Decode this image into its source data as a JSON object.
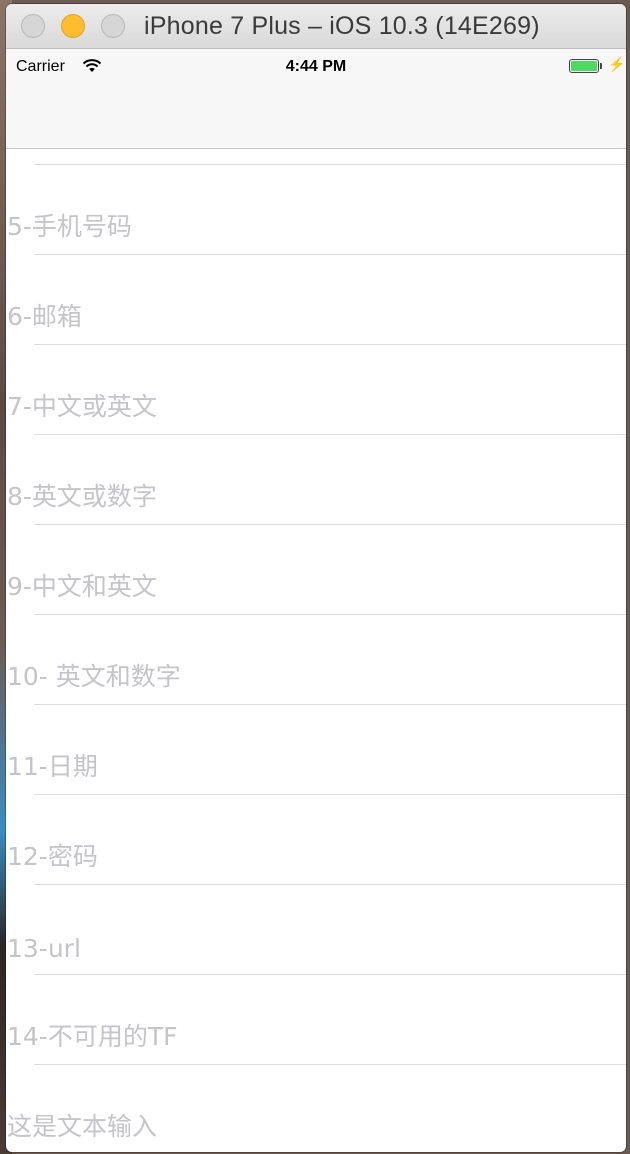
{
  "window": {
    "title": "iPhone 7 Plus – iOS 10.3 (14E269)"
  },
  "status_bar": {
    "carrier": "Carrier",
    "time": "4:44 PM",
    "wifi_icon": "wifi-icon",
    "battery_icon": "battery-icon",
    "charging_icon": "charging-bolt-icon"
  },
  "rows": [
    {
      "placeholder": "5-手机号码"
    },
    {
      "placeholder": "6-邮箱"
    },
    {
      "placeholder": "7-中文或英文"
    },
    {
      "placeholder": "8-英文或数字"
    },
    {
      "placeholder": "9-中文和英文"
    },
    {
      "placeholder": "10- 英文和数字"
    },
    {
      "placeholder": "11-日期"
    },
    {
      "placeholder": "12-密码"
    },
    {
      "placeholder": "13-url"
    },
    {
      "placeholder": "14-不可用的TF"
    },
    {
      "placeholder": "这是文本输入"
    }
  ]
}
